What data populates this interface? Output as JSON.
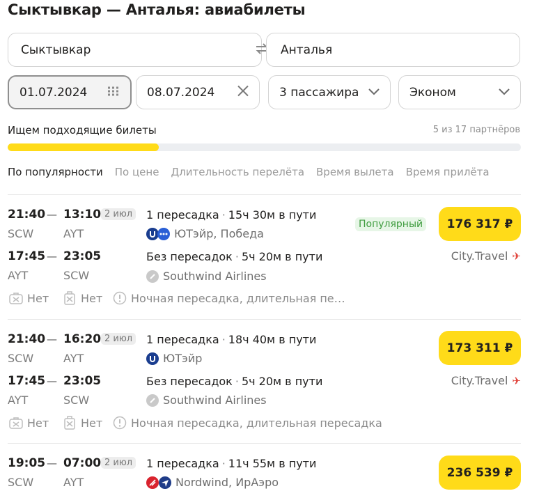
{
  "page_title": "Сыктывкар — Анталья: авиабилеты",
  "search": {
    "from": "Сыктывкар",
    "to": "Анталья",
    "date_from": "01.07.2024",
    "date_to": "08.07.2024",
    "passengers": "3 пассажира",
    "class": "Эконом"
  },
  "progress": {
    "label": "Ищем подходящие билеты",
    "partners": "5 из 17 партнёров",
    "fraction": 0.294
  },
  "sort_tabs": [
    "По популярности",
    "По цене",
    "Длительность перелёта",
    "Время вылета",
    "Время прилёта"
  ],
  "results": [
    {
      "price": "176 317 ₽",
      "popular_badge": "Популярный",
      "agency": "City.Travel",
      "out": {
        "dep_time": "21:40",
        "arr_time": "13:10",
        "arr_date": "2 июл",
        "dep_code": "SCW",
        "arr_code": "AYT",
        "stops": "1 пересадка",
        "duration": "15ч 30м в пути",
        "airline": "ЮТэйр, Победа"
      },
      "back": {
        "dep_time": "17:45",
        "arr_time": "23:05",
        "dep_code": "AYT",
        "arr_code": "SCW",
        "stops": "Без пересадок",
        "duration": "5ч 20м в пути",
        "airline": "Southwind Airlines"
      },
      "baggage": "Нет",
      "hand_luggage": "Нет",
      "notes": "Ночная пересадка, длительная пе…"
    },
    {
      "price": "173 311 ₽",
      "agency": "City.Travel",
      "out": {
        "dep_time": "21:40",
        "arr_time": "16:20",
        "arr_date": "2 июл",
        "dep_code": "SCW",
        "arr_code": "AYT",
        "stops": "1 пересадка",
        "duration": "18ч 40м в пути",
        "airline": "ЮТэйр"
      },
      "back": {
        "dep_time": "17:45",
        "arr_time": "23:05",
        "dep_code": "AYT",
        "arr_code": "SCW",
        "stops": "Без пересадок",
        "duration": "5ч 20м в пути",
        "airline": "Southwind Airlines"
      },
      "baggage": "Нет",
      "hand_luggage": "Нет",
      "notes": "Ночная пересадка, длительная пересадка"
    },
    {
      "price": "236 539 ₽",
      "out": {
        "dep_time": "19:05",
        "arr_time": "07:00",
        "arr_date": "2 июл",
        "dep_code": "SCW",
        "arr_code": "AYT",
        "stops": "1 пересадка",
        "duration": "11ч 55м в пути",
        "airline": "Nordwind, ИрАэро"
      }
    }
  ],
  "colors": {
    "accent": "#ffdb19",
    "popular": "#3f9c3f",
    "utair": "#1a3d8f",
    "nordwind": "#d9232e"
  }
}
